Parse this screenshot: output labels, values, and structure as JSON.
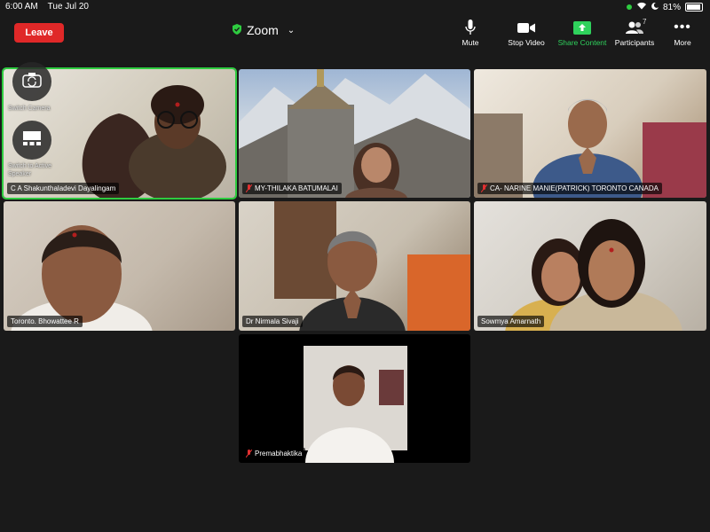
{
  "status": {
    "time": "6:00 AM",
    "date": "Tue Jul 20",
    "battery": "81%",
    "battery_level": 0.81
  },
  "header": {
    "leave_label": "Leave",
    "title": "Zoom",
    "toolbar": {
      "mute": "Mute",
      "stop_video": "Stop Video",
      "share_content": "Share Content",
      "participants": "Participants",
      "participants_count": "7",
      "more": "More"
    }
  },
  "overlay": {
    "switch_camera": "Switch Camera",
    "switch_to_active_speaker": "Switch to Active Speaker"
  },
  "participants": [
    {
      "name": "C A Shakunthaladevi Dayalingam",
      "muted": false,
      "active": true
    },
    {
      "name": "MY-THILAKA BATUMALAI",
      "muted": true,
      "active": false
    },
    {
      "name": "CA- NARINE MANIE(PATRICK) TORONTO CANADA",
      "muted": true,
      "active": false
    },
    {
      "name": "Toronto. Bhowattee R",
      "muted": false,
      "active": false
    },
    {
      "name": "Dr Nirmala Sivaji",
      "muted": false,
      "active": false
    },
    {
      "name": "Sowmya Amarnath",
      "muted": false,
      "active": false
    },
    {
      "name": "Premabhaktika",
      "muted": true,
      "active": false
    }
  ],
  "colors": {
    "leave": "#e02828",
    "share": "#2fd15c",
    "active_border": "#2ecc40",
    "muted_mic": "#e23030"
  }
}
